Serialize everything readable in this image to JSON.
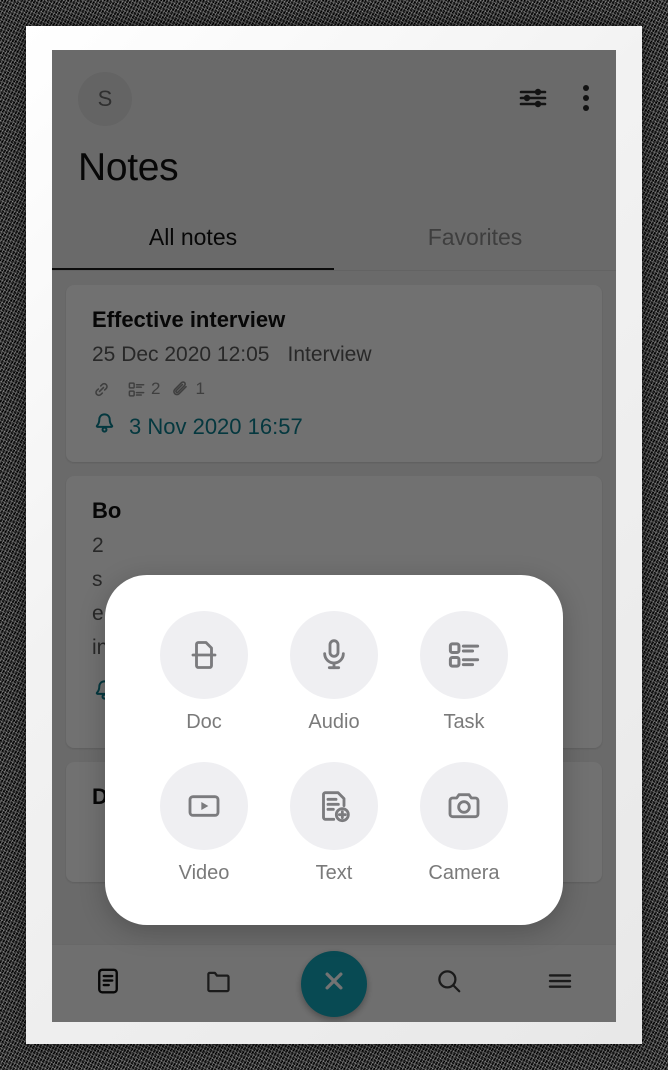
{
  "app": {
    "avatar_initial": "S",
    "title": "Notes",
    "accent_color": "#12A4B8",
    "reminder_color": "#0c7d8c"
  },
  "topbar": {
    "filter_icon": "sliders-icon",
    "overflow_icon": "more-vertical-icon"
  },
  "tabs": [
    {
      "label": "All notes",
      "active": true
    },
    {
      "label": "Favorites",
      "active": false
    }
  ],
  "notes": [
    {
      "title": "Effective interview",
      "date": "25 Dec 2020 12:05",
      "category": "Interview",
      "badges": [
        {
          "icon": "link-icon",
          "count": ""
        },
        {
          "icon": "task-icon",
          "count": "2"
        },
        {
          "icon": "attachment-icon",
          "count": "1"
        }
      ],
      "reminder": "3 Nov 2020 16:57"
    },
    {
      "title": "Bo",
      "date": "2",
      "line2": "s",
      "line3": "e",
      "line4": "in",
      "reminder": ""
    },
    {
      "title": "Desig"
    }
  ],
  "create_menu": {
    "items": [
      {
        "label": "Doc",
        "icon": "doc-icon"
      },
      {
        "label": "Audio",
        "icon": "microphone-icon"
      },
      {
        "label": "Task",
        "icon": "task-list-icon"
      },
      {
        "label": "Video",
        "icon": "video-icon"
      },
      {
        "label": "Text",
        "icon": "text-add-icon"
      },
      {
        "label": "Camera",
        "icon": "camera-icon"
      }
    ]
  },
  "bottom_nav": {
    "items": [
      {
        "icon": "notes-icon",
        "active": true
      },
      {
        "icon": "folder-icon",
        "active": false
      },
      {
        "icon": "close-icon",
        "fab": true
      },
      {
        "icon": "search-icon",
        "active": false
      },
      {
        "icon": "menu-icon",
        "active": false
      }
    ]
  }
}
